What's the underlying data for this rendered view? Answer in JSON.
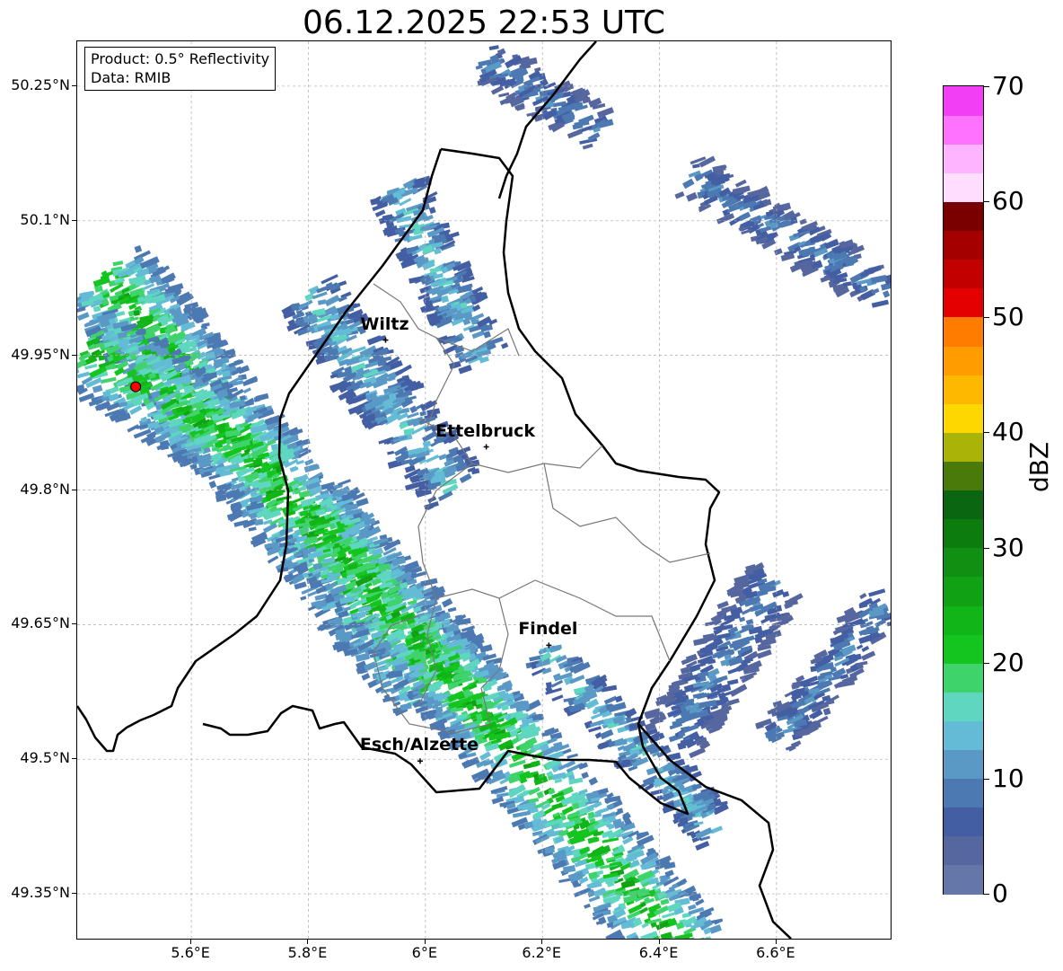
{
  "title": "06.12.2025 22:53 UTC",
  "info": {
    "product": "Product: 0.5° Reflectivity",
    "source": "Data: RMIB"
  },
  "map": {
    "extent": {
      "lon_min": 5.405,
      "lon_max": 6.795,
      "lat_min": 49.3,
      "lat_max": 50.3
    },
    "lat_ticks": [
      {
        "lat": 50.25,
        "label": "50.25°N"
      },
      {
        "lat": 50.1,
        "label": "50.1°N"
      },
      {
        "lat": 49.95,
        "label": "49.95°N"
      },
      {
        "lat": 49.8,
        "label": "49.8°N"
      },
      {
        "lat": 49.65,
        "label": "49.65°N"
      },
      {
        "lat": 49.5,
        "label": "49.5°N"
      },
      {
        "lat": 49.35,
        "label": "49.35°N"
      }
    ],
    "lon_ticks": [
      {
        "lon": 5.6,
        "label": "5.6°E"
      },
      {
        "lon": 5.8,
        "label": "5.8°E"
      },
      {
        "lon": 6.0,
        "label": "6°E"
      },
      {
        "lon": 6.2,
        "label": "6.2°E"
      },
      {
        "lon": 6.4,
        "label": "6.4°E"
      },
      {
        "lon": 6.6,
        "label": "6.6°E"
      }
    ],
    "cities": [
      {
        "name": "Wiltz",
        "lon": 5.932,
        "lat": 49.967
      },
      {
        "name": "Ettelbruck",
        "lon": 6.104,
        "lat": 49.848
      },
      {
        "name": "Findel",
        "lon": 6.211,
        "lat": 49.627
      },
      {
        "name": "Esch/Alzette",
        "lon": 5.991,
        "lat": 49.498
      }
    ],
    "radar_site": {
      "lon": 5.505,
      "lat": 49.915,
      "color": "#ff0000"
    },
    "echo_bands": [
      {
        "from": [
          5.45,
          50.04
        ],
        "to": [
          6.02,
          49.58
        ],
        "width": 0.11,
        "intensity": "high"
      },
      {
        "from": [
          5.8,
          49.78
        ],
        "to": [
          6.45,
          49.28
        ],
        "width": 0.1,
        "intensity": "high"
      },
      {
        "from": [
          5.8,
          50.02
        ],
        "to": [
          6.05,
          49.8
        ],
        "width": 0.07,
        "intensity": "mid"
      },
      {
        "from": [
          5.42,
          49.96
        ],
        "to": [
          5.75,
          49.82
        ],
        "width": 0.1,
        "intensity": "high"
      },
      {
        "from": [
          5.95,
          50.14
        ],
        "to": [
          6.1,
          49.94
        ],
        "width": 0.06,
        "intensity": "mid"
      },
      {
        "from": [
          6.1,
          50.28
        ],
        "to": [
          6.3,
          50.2
        ],
        "width": 0.05,
        "intensity": "low"
      },
      {
        "from": [
          6.45,
          50.15
        ],
        "to": [
          6.79,
          50.02
        ],
        "width": 0.05,
        "intensity": "low"
      },
      {
        "from": [
          6.6,
          49.7
        ],
        "to": [
          6.42,
          49.52
        ],
        "width": 0.07,
        "intensity": "low"
      },
      {
        "from": [
          6.79,
          49.68
        ],
        "to": [
          6.6,
          49.52
        ],
        "width": 0.05,
        "intensity": "low"
      },
      {
        "from": [
          6.2,
          49.62
        ],
        "to": [
          6.5,
          49.42
        ],
        "width": 0.05,
        "intensity": "mid"
      }
    ]
  },
  "colorbar": {
    "unit": "dBZ",
    "min": 0,
    "max": 70,
    "ticks": [
      0,
      10,
      20,
      30,
      40,
      50,
      60,
      70
    ],
    "colors": [
      "#6577a8",
      "#56679f",
      "#445ea3",
      "#4d79b2",
      "#5a99c6",
      "#63bbd6",
      "#5fd6c0",
      "#3fd36b",
      "#14c41f",
      "#12b517",
      "#11a115",
      "#108f12",
      "#0c7c0f",
      "#0a6610",
      "#4a7a0a",
      "#aab307",
      "#ffd700",
      "#ffb800",
      "#ff9c00",
      "#ff7c00",
      "#e40000",
      "#c20000",
      "#a50000",
      "#7a0000",
      "#ffddff",
      "#ffb4ff",
      "#ff72ff",
      "#f23ef4"
    ]
  }
}
